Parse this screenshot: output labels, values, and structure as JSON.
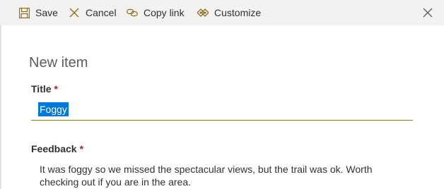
{
  "toolbar": {
    "save_label": "Save",
    "cancel_label": "Cancel",
    "copy_link_label": "Copy link",
    "customize_label": "Customize",
    "icons": {
      "save": "save-icon",
      "cancel": "cancel-icon",
      "copy_link": "link-icon",
      "customize": "customize-icon",
      "close": "close-icon"
    }
  },
  "panel": {
    "title": "New item"
  },
  "fields": {
    "title": {
      "label": "Title",
      "required_mark": "*",
      "value": "Foggy"
    },
    "feedback": {
      "label": "Feedback",
      "required_mark": "*",
      "value": "It was foggy so we missed the spectacular views, but the trail was ok. Worth checking out if you are in the area."
    }
  },
  "colors": {
    "toolbar_bg": "#f3f2f1",
    "accent": "#8a7a2a",
    "required": "#a4262c",
    "selection": "#0078d7"
  }
}
